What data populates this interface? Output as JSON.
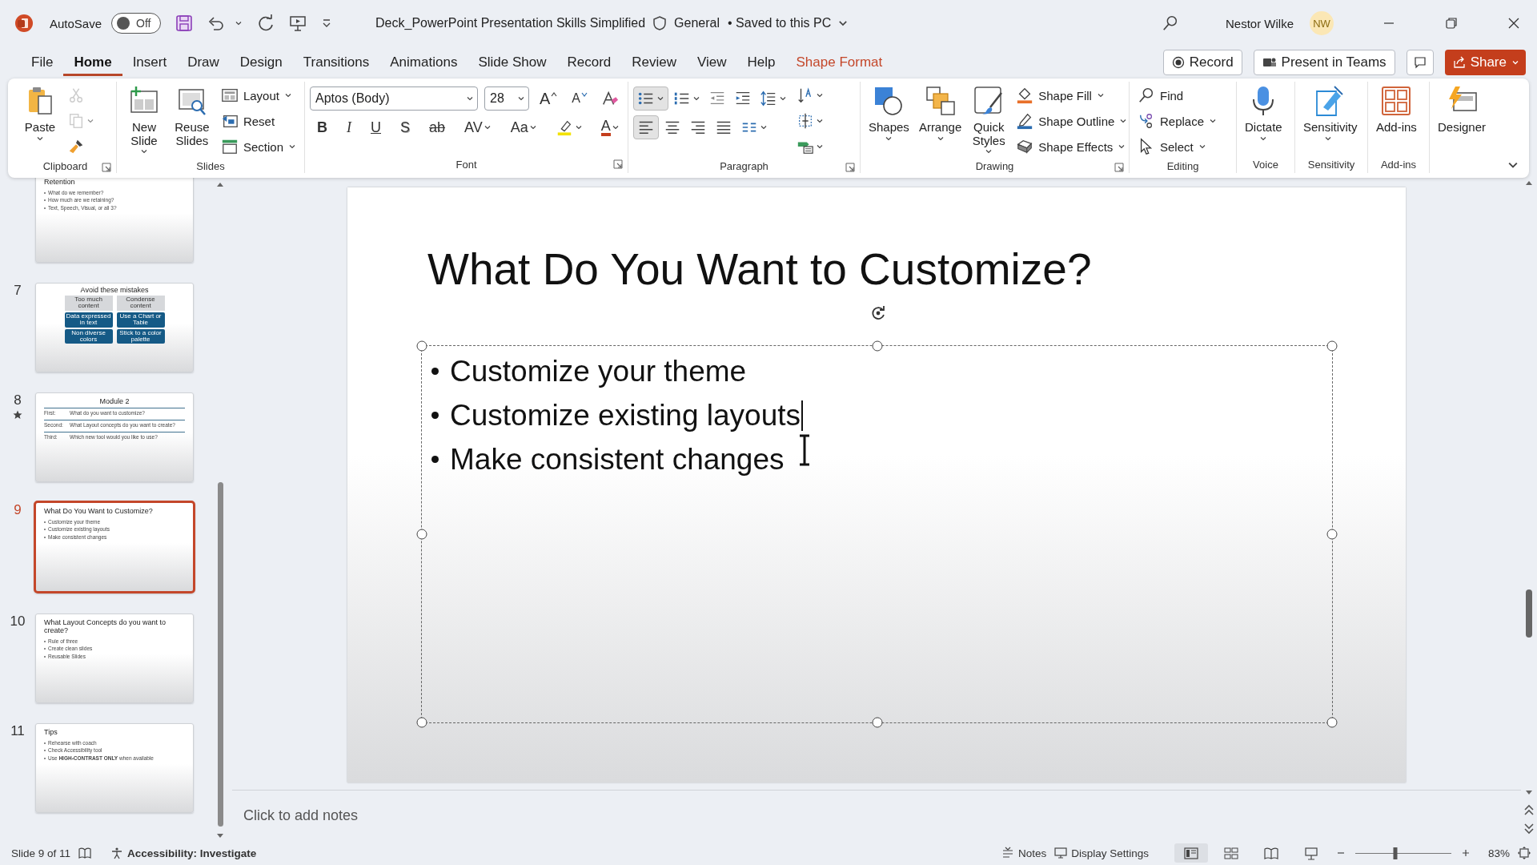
{
  "title_bar": {
    "autosave_label": "AutoSave",
    "autosave": {
      "on": false,
      "label": "Off"
    },
    "document_title": "Deck_PowerPoint Presentation Skills Simplified",
    "sensitivity": "General",
    "save_status": "• Saved to this PC",
    "user_name": "Nestor Wilke",
    "user_initials": "NW"
  },
  "ribbon_tabs": [
    {
      "label": "File",
      "selected": false,
      "kind": "normal"
    },
    {
      "label": "Home",
      "selected": true,
      "kind": "normal"
    },
    {
      "label": "Insert",
      "selected": false,
      "kind": "normal"
    },
    {
      "label": "Draw",
      "selected": false,
      "kind": "normal"
    },
    {
      "label": "Design",
      "selected": false,
      "kind": "normal"
    },
    {
      "label": "Transitions",
      "selected": false,
      "kind": "normal"
    },
    {
      "label": "Animations",
      "selected": false,
      "kind": "normal"
    },
    {
      "label": "Slide Show",
      "selected": false,
      "kind": "normal"
    },
    {
      "label": "Record",
      "selected": false,
      "kind": "normal"
    },
    {
      "label": "Review",
      "selected": false,
      "kind": "normal"
    },
    {
      "label": "View",
      "selected": false,
      "kind": "normal"
    },
    {
      "label": "Help",
      "selected": false,
      "kind": "normal"
    },
    {
      "label": "Shape Format",
      "selected": false,
      "kind": "contextual"
    }
  ],
  "ribbon_actions": {
    "record": "Record",
    "present": "Present in Teams",
    "share": "Share"
  },
  "ribbon_groups": [
    {
      "label": "Clipboard",
      "launcher": true,
      "sections": [
        {
          "kind": "large",
          "items": [
            {
              "label": "Paste",
              "dropdown": true
            }
          ]
        },
        {
          "kind": "stack",
          "items": [
            {
              "dropdown": false,
              "disabled": true
            },
            {
              "dropdown": true,
              "disabled": true
            },
            {
              "dropdown": false,
              "disabled": false
            }
          ]
        }
      ]
    },
    {
      "label": "Slides",
      "launcher": false,
      "sections": [
        {
          "kind": "large",
          "items": [
            {
              "label": "New Slide",
              "dropdown": true
            }
          ]
        },
        {
          "kind": "large",
          "items": [
            {
              "label": "Reuse Slides",
              "dropdown": false
            }
          ]
        },
        {
          "kind": "stack",
          "items": [
            {
              "label": "Layout",
              "dropdown": true
            },
            {
              "label": "Reset",
              "dropdown": false
            },
            {
              "label": "Section",
              "dropdown": true
            }
          ]
        }
      ]
    },
    {
      "label": "Font",
      "launcher": true,
      "sections": [
        {
          "kind": "rows",
          "rows": [
            {
              "items": [
                {
                  "kind": "font-name",
                  "value": "Aptos (Body)"
                },
                {
                  "kind": "font-size",
                  "value": "28"
                },
                {
                  "kind": "grow",
                  "text": "A"
                },
                {
                  "kind": "shrink",
                  "text": "A"
                },
                {
                  "kind": "icon",
                  "dropdown": false
                }
              ]
            },
            {
              "items": [
                {
                  "kind": "bold",
                  "text": "B"
                },
                {
                  "kind": "italic",
                  "text": "I"
                },
                {
                  "kind": "underline",
                  "text": "U"
                },
                {
                  "kind": "shadow",
                  "text": "S"
                },
                {
                  "kind": "strike",
                  "text": "ab"
                },
                {
                  "kind": "spacing",
                  "text": "AV",
                  "dropdown": true
                },
                {
                  "kind": "case",
                  "text": "Aa",
                  "dropdown": true
                },
                {
                  "kind": "icon",
                  "dropdown": true
                },
                {
                  "kind": "font-color",
                  "text": "A",
                  "dropdown": true
                }
              ]
            }
          ]
        }
      ]
    },
    {
      "label": "Paragraph",
      "launcher": true,
      "sections": [
        {
          "kind": "rows",
          "rows": [
            {
              "items": [
                {
                  "kind": "icon",
                  "dropdown": true,
                  "selected": true
                },
                {
                  "kind": "icon",
                  "dropdown": true,
                  "selected": false
                },
                {
                  "kind": "icon",
                  "dropdown": false,
                  "selected": false
                },
                {
                  "kind": "icon",
                  "dropdown": false,
                  "selected": false
                },
                {
                  "kind": "icon",
                  "dropdown": true,
                  "selected": false
                }
              ]
            },
            {
              "items": [
                {
                  "kind": "icon",
                  "dropdown": false,
                  "selected": true
                },
                {
                  "kind": "icon",
                  "dropdown": false,
                  "selected": false
                },
                {
                  "kind": "icon",
                  "dropdown": false,
                  "selected": false
                },
                {
                  "kind": "icon",
                  "dropdown": false,
                  "selected": false
                },
                {
                  "kind": "icon",
                  "dropdown": true,
                  "selected": false
                }
              ]
            }
          ]
        },
        {
          "kind": "stack",
          "items": [
            {
              "dropdown": true
            },
            {
              "dropdown": true
            },
            {
              "dropdown": true
            }
          ]
        }
      ]
    },
    {
      "label": "Drawing",
      "launcher": true,
      "sections": [
        {
          "kind": "large",
          "items": [
            {
              "label": "Shapes",
              "dropdown": true
            }
          ]
        },
        {
          "kind": "large",
          "items": [
            {
              "label": "Arrange",
              "dropdown": true
            }
          ]
        },
        {
          "kind": "large",
          "items": [
            {
              "label": "Quick Styles",
              "dropdown": true
            }
          ]
        },
        {
          "kind": "stack",
          "items": [
            {
              "label": "Shape Fill",
              "dropdown": true
            },
            {
              "label": "Shape Outline",
              "dropdown": true
            },
            {
              "label": "Shape Effects",
              "dropdown": true
            }
          ]
        }
      ]
    },
    {
      "label": "Editing",
      "launcher": false,
      "sections": [
        {
          "kind": "stack",
          "items": [
            {
              "label": "Find",
              "dropdown": false
            },
            {
              "label": "Replace",
              "dropdown": true
            },
            {
              "label": "Select",
              "dropdown": true
            }
          ]
        }
      ]
    },
    {
      "label": "Voice",
      "launcher": false,
      "sections": [
        {
          "kind": "large",
          "items": [
            {
              "label": "Dictate",
              "dropdown": true
            }
          ]
        }
      ]
    },
    {
      "label": "Sensitivity",
      "launcher": false,
      "sections": [
        {
          "kind": "large",
          "items": [
            {
              "label": "Sensitivity",
              "dropdown": true
            }
          ]
        }
      ]
    },
    {
      "label": "Add-ins",
      "launcher": false,
      "sections": [
        {
          "kind": "large",
          "items": [
            {
              "label": "Add-ins",
              "dropdown": false
            }
          ]
        }
      ]
    },
    {
      "launcher": false,
      "sections": [
        {
          "kind": "large",
          "items": [
            {
              "label": "Designer",
              "dropdown": false
            }
          ]
        }
      ]
    }
  ],
  "slides": [
    {
      "kind": "bullets",
      "selected": false,
      "transition": false,
      "title": "Retention",
      "bullets": [
        "What do we remember?",
        "How much are we retaining?",
        "Text, Speech, Visual, or all 3?"
      ]
    },
    {
      "kind": "diagram",
      "number": "7",
      "selected": false,
      "transition": false,
      "title": "Avoid these mistakes",
      "columns": [
        {
          "header": "Too much content",
          "items": [
            "Data expressed in text",
            "Non diverse colors"
          ]
        },
        {
          "header": "Condense content",
          "items": [
            "Use a Chart or Table",
            "Stick to a color palette"
          ]
        }
      ]
    },
    {
      "kind": "table",
      "number": "8",
      "selected": false,
      "transition": true,
      "title": "Module 2",
      "rows": [
        [
          "First:",
          "What do you want to customize?"
        ],
        [
          "Second:",
          "What Layout concepts do you want to create?"
        ],
        [
          "Third:",
          "Which new tool would you like to use?"
        ]
      ]
    },
    {
      "kind": "bullets",
      "number": "9",
      "selected": true,
      "transition": false,
      "title": "What Do You Want to Customize?",
      "bullets": [
        "Customize your theme",
        "Customize existing layouts",
        "Make consistent changes"
      ]
    },
    {
      "kind": "bullets",
      "number": "10",
      "selected": false,
      "transition": false,
      "title": "What Layout Concepts do you want to create?",
      "bullets": [
        "Rule of three",
        "Create clean slides",
        "Reusable Slides"
      ]
    },
    {
      "kind": "bullets",
      "number": "11",
      "selected": false,
      "transition": false,
      "title": "Tips",
      "bullets": [
        "Rehearse with coach",
        "Check Accessibility tool",
        "Use **HIGH-CONTRAST ONLY** when available"
      ]
    }
  ],
  "slide": {
    "title": "What Do You Want to Customize?",
    "bullets": [
      {
        "text": "Customize your theme",
        "caret": false
      },
      {
        "text": "Customize existing layouts",
        "caret": true
      },
      {
        "text": "Make consistent changes",
        "caret": false
      }
    ]
  },
  "notes": {
    "placeholder": "Click to add notes"
  },
  "status_bar": {
    "slide_info": "Slide 9 of 11",
    "accessibility": "Accessibility: Investigate",
    "notes": "Notes",
    "display_settings": "Display Settings",
    "views": [
      {
        "selected": true
      },
      {
        "selected": false
      },
      {
        "selected": false
      },
      {
        "selected": false
      }
    ],
    "zoom": {
      "level": 0.42,
      "reading": "83%"
    }
  }
}
